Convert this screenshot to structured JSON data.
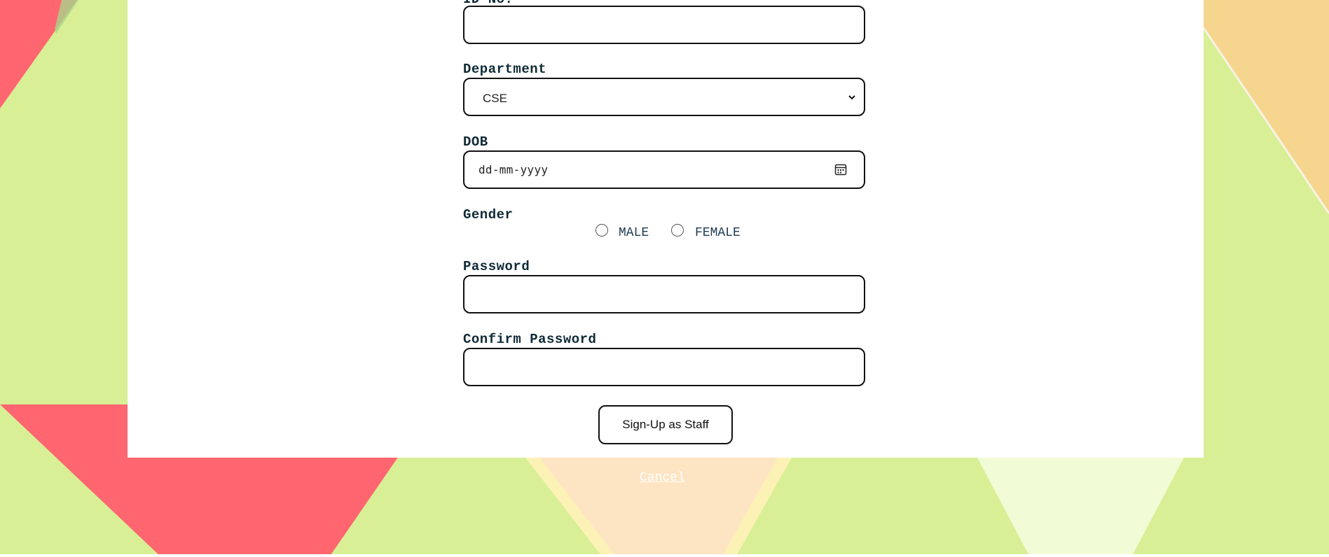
{
  "colors": {
    "background_green": "#d8ef96",
    "background_red": "#ff6670",
    "background_orange": "#f6d58f",
    "label_color": "#0f2a36",
    "card": "#ffffff"
  },
  "form": {
    "partial_top_label": "ID No.",
    "department": {
      "label": "Department",
      "selected": "CSE"
    },
    "dob": {
      "label": "DOB",
      "placeholder": "dd-mm-yyyy"
    },
    "gender": {
      "label": "Gender",
      "options": [
        "MALE",
        "FEMALE"
      ]
    },
    "password": {
      "label": "Password"
    },
    "confirm_password": {
      "label": "Confirm Password"
    },
    "submit_label": "Sign-Up as Staff",
    "cancel_label": "Cancel"
  }
}
